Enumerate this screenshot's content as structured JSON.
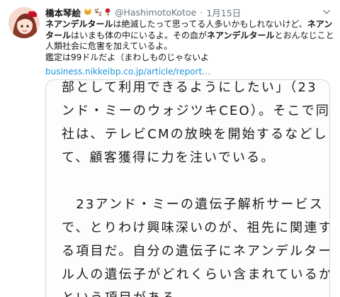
{
  "tweet": {
    "display_name": "橋本琴絵",
    "handle": "@HashimotoKotoe",
    "separator": "·",
    "date": "1月15日",
    "badge_icons": [
      "cat-face-icon",
      "paw-prints-icon",
      "rose-icon"
    ],
    "text_lines": [
      [
        {
          "t": "ネアンデルタール",
          "b": true
        },
        {
          "t": "は絶滅したって思ってる人多いかもしれないけど、",
          "b": false
        },
        {
          "t": "ネアンデル",
          "b": true
        }
      ],
      [
        {
          "t": "タール",
          "b": true
        },
        {
          "t": "はいまも体の中にいるよ。その血が",
          "b": false
        },
        {
          "t": "ネアンデルタール",
          "b": true
        },
        {
          "t": "とおんなじことして",
          "b": false
        }
      ],
      [
        {
          "t": "人類社会に危害を加えているよ。",
          "b": false
        }
      ],
      [
        {
          "t": "鑑定は99ドルだよ（まわしものじゃないよ",
          "b": false
        }
      ]
    ],
    "link_text": "business.nikkeibp.co.jp/article/report…"
  },
  "media": {
    "lines": [
      "部として利用できるようにしたい」（23",
      "ンド・ミーのウォジツキCEO）。そこで同",
      "社は、テレビCMの放映を開始するなどし",
      "て、顧客獲得に力を注いでいる。",
      "",
      "　23アンド・ミーの遺伝子解析サービス",
      "で、とりわけ興味深いのが、祖先に関連す",
      "る項目だ。自分の遺伝子にネアンデルター",
      "ル人の遺伝子がどれくらい含まれているか",
      "という項目がある。"
    ]
  }
}
